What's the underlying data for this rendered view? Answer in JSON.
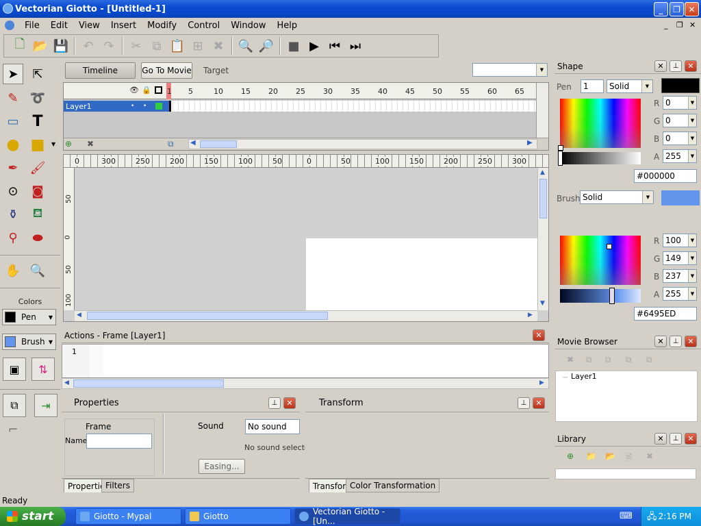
{
  "window": {
    "title": "Vectorian Giotto - [Untitled-1]"
  },
  "menu": [
    "File",
    "Edit",
    "View",
    "Insert",
    "Modify",
    "Control",
    "Window",
    "Help"
  ],
  "timeline": {
    "timeline_btn": "Timeline",
    "goto_btn": "Go To Movie",
    "target_label": "Target",
    "frame_numbers": [
      "1",
      "5",
      "10",
      "15",
      "20",
      "25",
      "30",
      "35",
      "40",
      "45",
      "50",
      "55",
      "60",
      "65"
    ],
    "layer_name": "Layer1"
  },
  "stage": {
    "h_ruler": [
      "0",
      "300",
      "250",
      "200",
      "150",
      "100",
      "50",
      "0",
      "50",
      "100",
      "150",
      "200",
      "250",
      "300"
    ],
    "v_ruler": [
      "50",
      "0",
      "50",
      "100"
    ]
  },
  "colors_panel": {
    "title": "Colors",
    "pen_label": "Pen",
    "brush_label": "Brush",
    "pen_color": "#000000",
    "brush_color": "#6495ED"
  },
  "actions": {
    "title": "Actions - Frame [Layer1]",
    "line_number": "1"
  },
  "properties": {
    "title": "Properties",
    "frame_label": "Frame",
    "name_label": "Name",
    "sound_label": "Sound",
    "sound_value": "No sound",
    "sound_status": "No sound selecte",
    "easing_btn": "Easing...",
    "tabs": [
      "Properties",
      "Filters"
    ]
  },
  "transform": {
    "title": "Transform",
    "tabs": [
      "Transform",
      "Color Transformation"
    ]
  },
  "shape": {
    "title": "Shape",
    "pen_label": "Pen",
    "pen_width": "1",
    "pen_style": "Solid",
    "pen": {
      "r": "0",
      "g": "0",
      "b": "0",
      "a": "255",
      "hex": "#000000"
    },
    "brush_label": "Brush",
    "brush_style": "Solid",
    "brush": {
      "r": "100",
      "g": "149",
      "b": "237",
      "a": "255",
      "hex": "#6495ED"
    },
    "channel_labels": [
      "R",
      "G",
      "B",
      "A"
    ]
  },
  "movie_browser": {
    "title": "Movie Browser",
    "tree_item": "Layer1"
  },
  "library": {
    "title": "Library"
  },
  "status": {
    "text": "Ready"
  },
  "taskbar": {
    "start": "start",
    "tasks": [
      "Giotto - Mypal",
      "Giotto",
      "Vectorian Giotto - [Un..."
    ],
    "clock": "2:16 PM"
  }
}
